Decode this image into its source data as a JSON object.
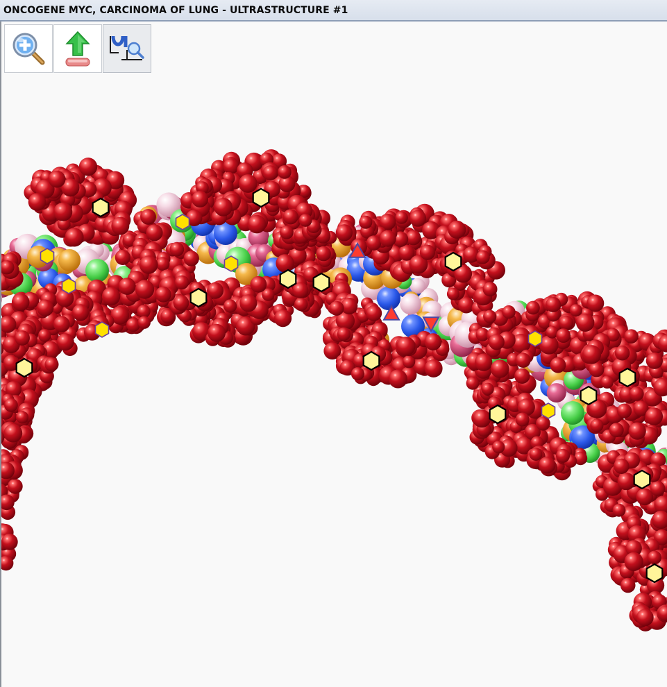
{
  "window": {
    "title": "ONCOGENE MYC, CARCINOMA OF LUNG - ULTRASTRUCTURE #1"
  },
  "toolbar": {
    "buttons": [
      {
        "name": "zoom-in-button",
        "icon": "magnifier-plus-icon",
        "active": false
      },
      {
        "name": "upload-button",
        "icon": "green-up-arrow-icon",
        "active": false
      },
      {
        "name": "structure-inspect-button",
        "icon": "structure-magnifier-icon",
        "active": true
      }
    ]
  },
  "viewer": {
    "content": "dna-helix-space-filling-model",
    "markers": {
      "hexagon_fill": "#fff59a",
      "hexagon_small_fill": "#ffe100",
      "triangle_fill": "#ff3b2f",
      "triangle_stroke": "#4b49a3"
    },
    "colors": {
      "backbone": "#b0101c",
      "base_blue": "#2a58e8",
      "base_green": "#52d84f",
      "base_pink": "#f1cfdd",
      "base_orange": "#f0a12a"
    }
  }
}
